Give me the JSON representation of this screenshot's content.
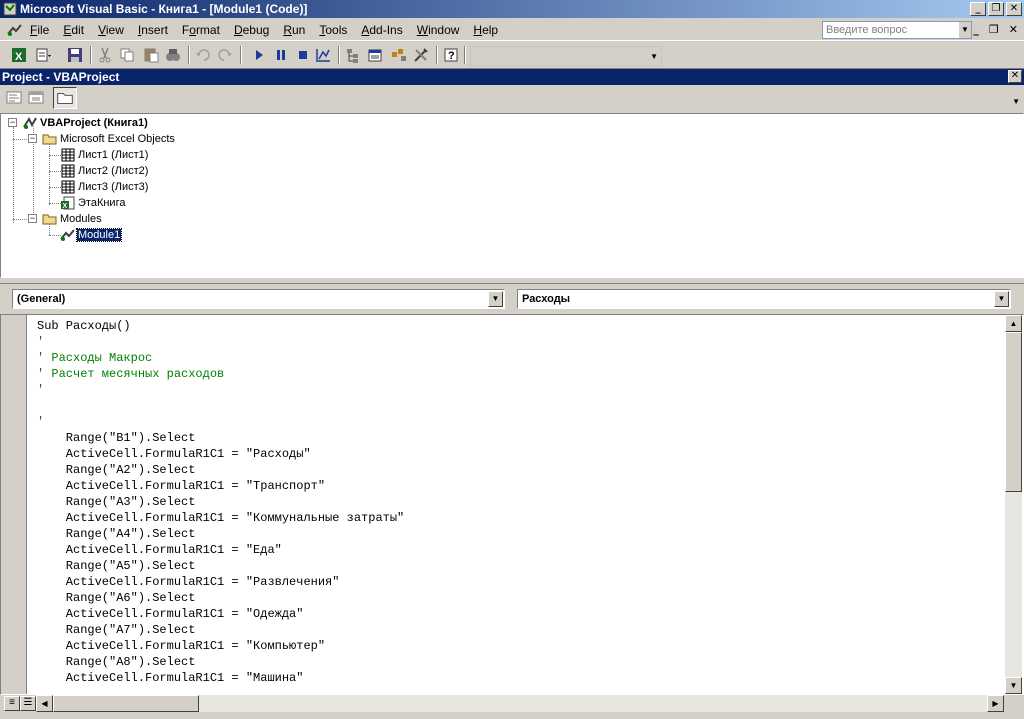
{
  "window": {
    "title": "Microsoft Visual Basic - Книга1 - [Module1 (Code)]",
    "controls": [
      "_",
      "❐",
      "✕"
    ]
  },
  "menubar": {
    "items": [
      {
        "label": "File",
        "accel": "F"
      },
      {
        "label": "Edit",
        "accel": "E"
      },
      {
        "label": "View",
        "accel": "V"
      },
      {
        "label": "Insert",
        "accel": "I"
      },
      {
        "label": "Format",
        "accel": "o"
      },
      {
        "label": "Debug",
        "accel": "D"
      },
      {
        "label": "Run",
        "accel": "R"
      },
      {
        "label": "Tools",
        "accel": "T"
      },
      {
        "label": "Add-Ins",
        "accel": "A"
      },
      {
        "label": "Window",
        "accel": "W"
      },
      {
        "label": "Help",
        "accel": "H"
      }
    ],
    "help_placeholder": "Введите вопрос",
    "mdi_controls": [
      "_",
      "❐",
      "✕"
    ]
  },
  "toolbar": {
    "icons": [
      "excel-icon",
      "insert-module-icon",
      "save-icon",
      "cut-icon",
      "copy-icon",
      "paste-icon",
      "find-icon",
      "undo-icon",
      "redo-icon",
      "run-icon",
      "break-icon",
      "reset-icon",
      "design-mode-icon",
      "project-explorer-icon",
      "properties-icon",
      "object-browser-icon",
      "toolbox-icon",
      "help-icon"
    ]
  },
  "project": {
    "title": "Project - VBAProject",
    "tree": {
      "root": "VBAProject (Книга1)",
      "folder_objects": "Microsoft Excel Objects",
      "sheets": [
        "Лист1 (Лист1)",
        "Лист2 (Лист2)",
        "Лист3 (Лист3)"
      ],
      "workbook": "ЭтаКнига",
      "folder_modules": "Modules",
      "module": "Module1"
    }
  },
  "code_window": {
    "object_combo": "(General)",
    "proc_combo": "Расходы",
    "lines": [
      {
        "text": "Sub Расходы()",
        "type": "code"
      },
      {
        "text": "'",
        "type": "comment"
      },
      {
        "text": "' Расходы Макрос",
        "type": "comment"
      },
      {
        "text": "' Расчет месячных расходов",
        "type": "comment"
      },
      {
        "text": "'",
        "type": "comment"
      },
      {
        "text": "",
        "type": "code"
      },
      {
        "text": "'",
        "type": "comment"
      },
      {
        "text": "    Range(\"B1\").Select",
        "type": "code"
      },
      {
        "text": "    ActiveCell.FormulaR1C1 = \"Расходы\"",
        "type": "code"
      },
      {
        "text": "    Range(\"A2\").Select",
        "type": "code"
      },
      {
        "text": "    ActiveCell.FormulaR1C1 = \"Транспорт\"",
        "type": "code"
      },
      {
        "text": "    Range(\"A3\").Select",
        "type": "code"
      },
      {
        "text": "    ActiveCell.FormulaR1C1 = \"Коммунальные затраты\"",
        "type": "code"
      },
      {
        "text": "    Range(\"A4\").Select",
        "type": "code"
      },
      {
        "text": "    ActiveCell.FormulaR1C1 = \"Еда\"",
        "type": "code"
      },
      {
        "text": "    Range(\"A5\").Select",
        "type": "code"
      },
      {
        "text": "    ActiveCell.FormulaR1C1 = \"Развлечения\"",
        "type": "code"
      },
      {
        "text": "    Range(\"A6\").Select",
        "type": "code"
      },
      {
        "text": "    ActiveCell.FormulaR1C1 = \"Одежда\"",
        "type": "code"
      },
      {
        "text": "    Range(\"A7\").Select",
        "type": "code"
      },
      {
        "text": "    ActiveCell.FormulaR1C1 = \"Компьютер\"",
        "type": "code"
      },
      {
        "text": "    Range(\"A8\").Select",
        "type": "code"
      },
      {
        "text": "    ActiveCell.FormulaR1C1 = \"Машина\"",
        "type": "code"
      }
    ]
  },
  "colors": {
    "title_bar": "#0a246a",
    "comment": "#008000",
    "selection": "#0a246a",
    "chrome": "#d4d0c8"
  }
}
